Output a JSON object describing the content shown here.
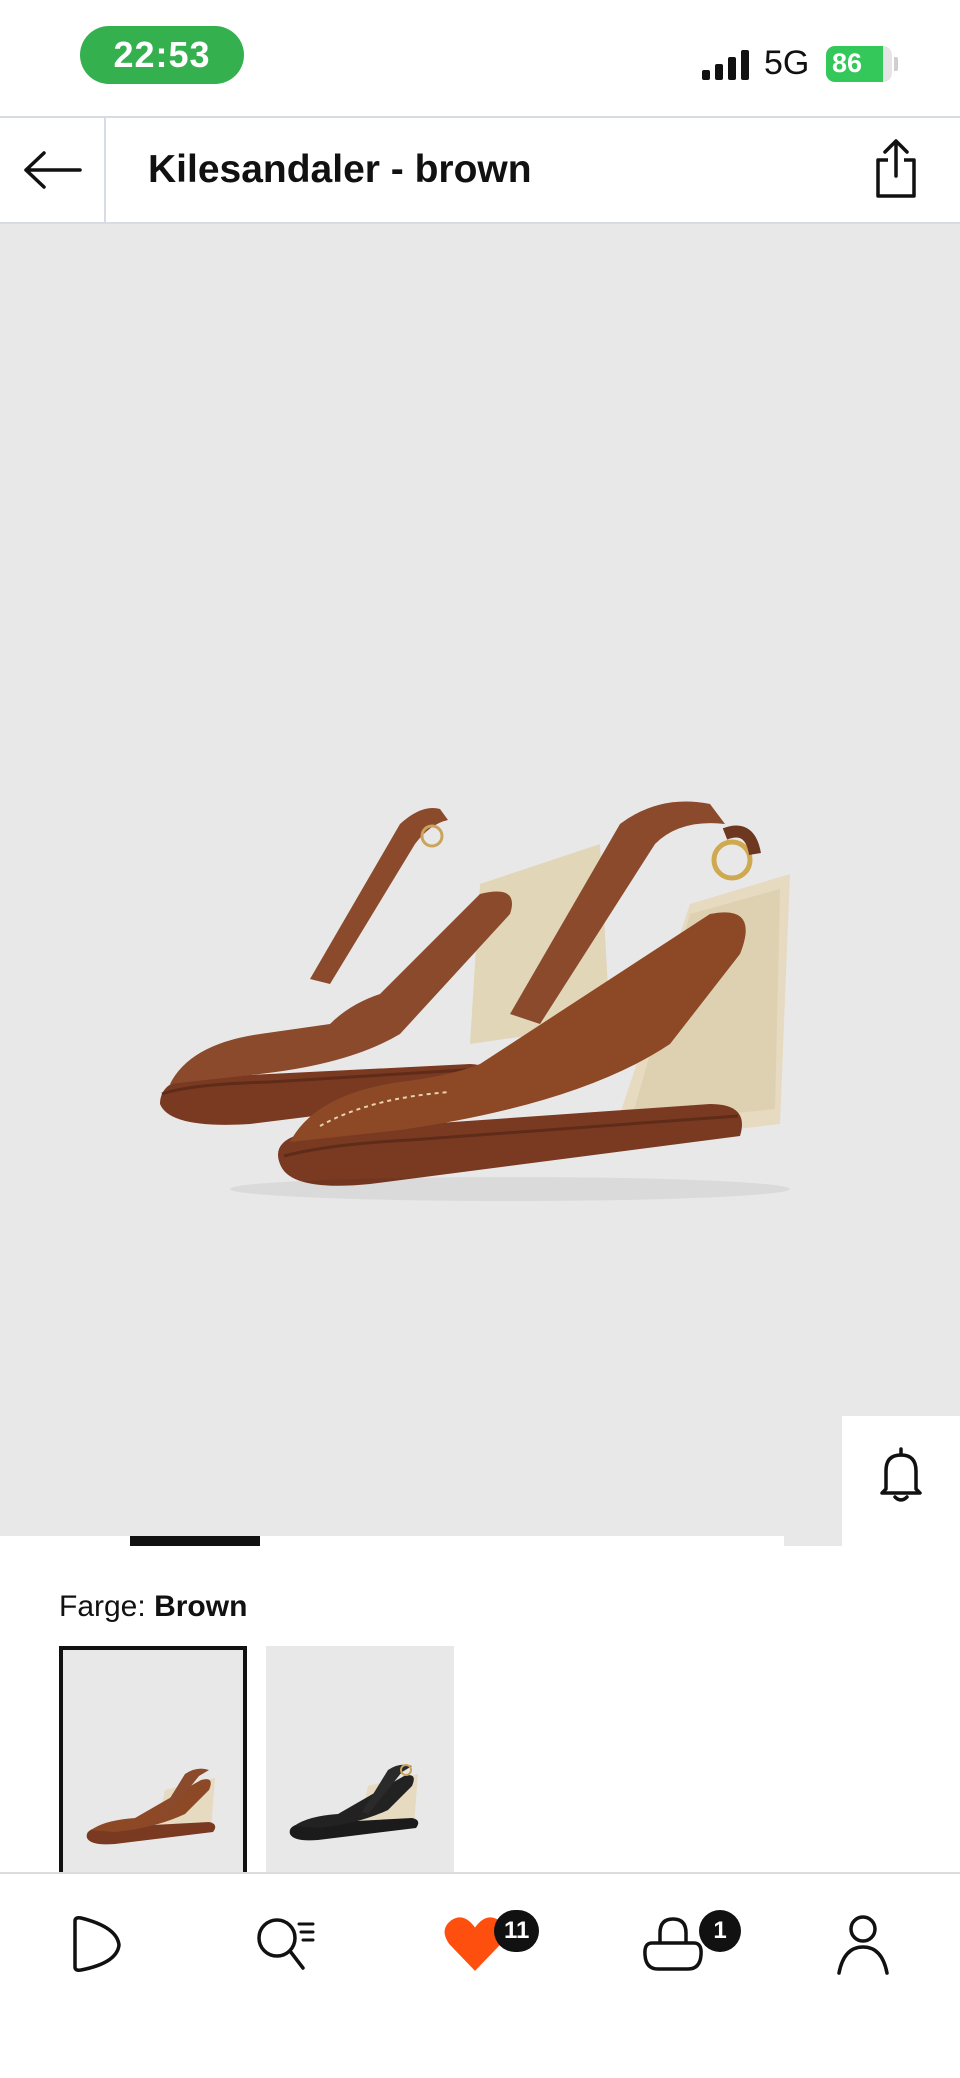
{
  "status_bar": {
    "time": "22:53",
    "network": "5G",
    "battery_level": 86,
    "battery_text": "86"
  },
  "header": {
    "title": "Kilesandaler - brown"
  },
  "product": {
    "image_count_indicator": {
      "active_index": 1,
      "total": 5
    }
  },
  "color": {
    "label": "Farge:",
    "value": "Brown",
    "options": [
      "Brown",
      "Black"
    ]
  },
  "bottom_nav": {
    "favorites_count": "11",
    "cart_count": "1"
  },
  "colors": {
    "accent": "#ff4f0f",
    "status_green": "#34b04f",
    "product_bg": "#e9e8e9"
  },
  "icons": {
    "back": "arrow-left-icon",
    "share": "share-icon",
    "notify": "bell-icon",
    "favorite": "heart-icon",
    "add_to_bag": "bag-icon",
    "ai_assistant": "sparkle-chat-icon",
    "nav_home": "home-icon",
    "nav_search": "search-icon",
    "nav_favorites": "heart-icon",
    "nav_cart": "cart-icon",
    "nav_profile": "profile-icon"
  }
}
